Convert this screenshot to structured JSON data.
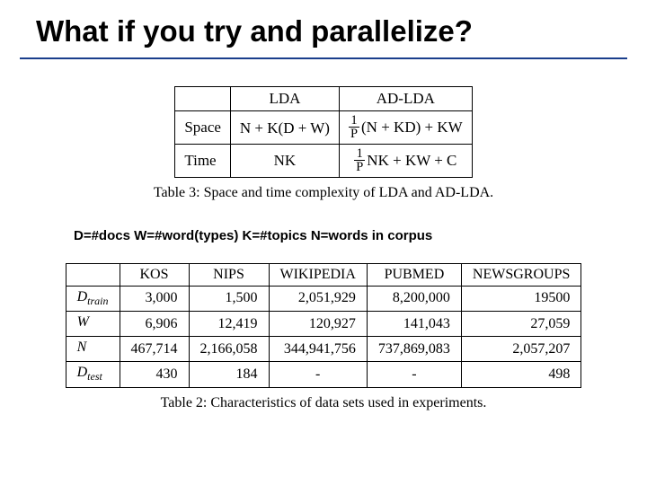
{
  "title": "What if you try and parallelize?",
  "table3": {
    "headers": [
      "",
      "LDA",
      "AD-LDA"
    ],
    "rows": [
      {
        "label": "Space",
        "lda_html": "N + K(D + W)",
        "adlda_frac_num": "1",
        "adlda_frac_den": "P",
        "adlda_tail": "(N + KD) + KW"
      },
      {
        "label": "Time",
        "lda_html": "NK",
        "adlda_frac_num": "1",
        "adlda_frac_den": "P",
        "adlda_tail": "NK + KW + C"
      }
    ],
    "caption": "Table 3: Space and time complexity of LDA and AD-LDA."
  },
  "note": "D=#docs W=#word(types) K=#topics N=words in corpus",
  "table2": {
    "headers": [
      "",
      "KOS",
      "NIPS",
      "WIKIPEDIA",
      "PUBMED",
      "NEWSGROUPS"
    ],
    "rows": [
      {
        "label_main": "D",
        "label_sub": "train",
        "cells": [
          "3,000",
          "1,500",
          "2,051,929",
          "8,200,000",
          "19500"
        ]
      },
      {
        "label_main": "W",
        "label_sub": "",
        "cells": [
          "6,906",
          "12,419",
          "120,927",
          "141,043",
          "27,059"
        ]
      },
      {
        "label_main": "N",
        "label_sub": "",
        "cells": [
          "467,714",
          "2,166,058",
          "344,941,756",
          "737,869,083",
          "2,057,207"
        ]
      },
      {
        "label_main": "D",
        "label_sub": "test",
        "cells": [
          "430",
          "184",
          "-",
          "-",
          "498"
        ]
      }
    ],
    "caption": "Table 2: Characteristics of data sets used in experiments."
  }
}
